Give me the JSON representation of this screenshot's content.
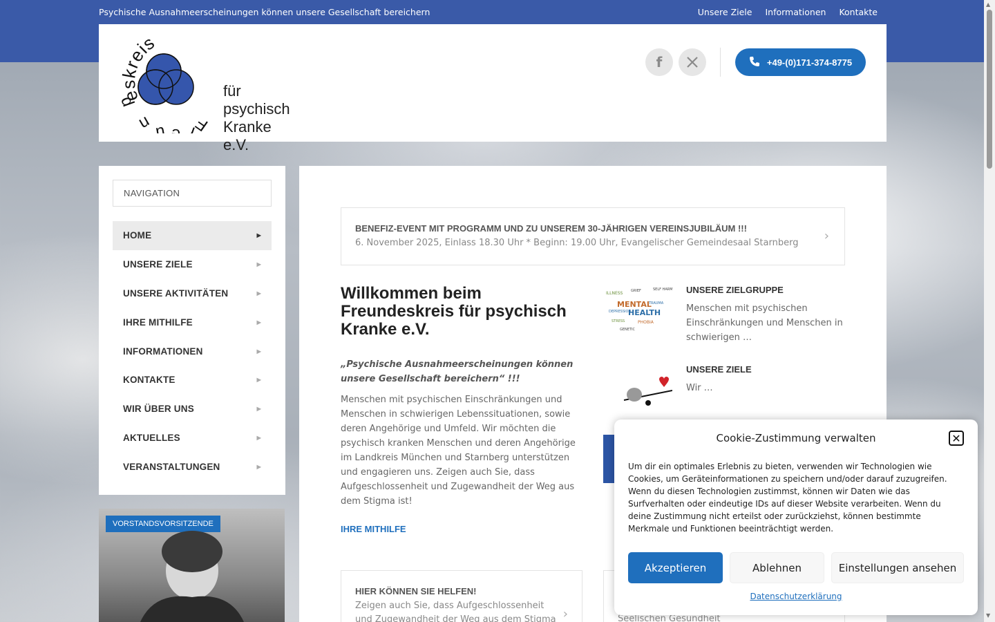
{
  "topbar": {
    "tagline": "Psychische Ausnahmeerscheinungen können unsere Gesellschaft bereichern",
    "links": [
      "Unsere Ziele",
      "Informationen",
      "Kontakte"
    ]
  },
  "header": {
    "logo_arc_text": "Freundeskreis",
    "logo_line1": "für psychisch",
    "logo_line2": "Kranke e.V.",
    "social_icons": [
      "facebook-icon",
      "x-icon"
    ],
    "phone": "+49-(0)171-374-8775",
    "accent_color": "#1f6fbd",
    "topbar_color": "#3a5aa8"
  },
  "sidebar": {
    "nav_heading": "NAVIGATION",
    "items": [
      {
        "label": "HOME",
        "active": true
      },
      {
        "label": "UNSERE ZIELE"
      },
      {
        "label": "UNSERE AKTIVITÄTEN"
      },
      {
        "label": "IHRE MITHILFE"
      },
      {
        "label": "INFORMATIONEN"
      },
      {
        "label": "KONTAKTE"
      },
      {
        "label": "WIR ÜBER UNS"
      },
      {
        "label": "AKTUELLES"
      },
      {
        "label": "VERANSTALTUNGEN"
      }
    ],
    "board_tag": "VORSTANDSVORSITZENDE"
  },
  "main": {
    "event_title": "BENEFIZ-EVENT MIT PROGRAMM UND ZU UNSEREM 30-JÄHRIGEN VEREINSJUBILÄUM !!!",
    "event_desc": "6. November 2025, Einlass 18.30 Uhr  * Beginn: 19.00 Uhr, Evangelischer Gemeindesaal Starnberg",
    "welcome_title": "Willkommen beim Freundeskreis für psychisch Kranke e.V.",
    "quote": "„Psychische Ausnahmeerscheinungen können unsere Gesellschaft bereichern“ !!!",
    "intro": "Menschen mit psychischen Einschränkungen und Menschen in schwierigen Lebenssituationen, sowie deren Angehörige und Umfeld. Wir möchten die psychisch kranken Menschen und deren Angehörige im Landkreis München und Starnberg unterstützen und engagieren uns. Zeigen auch Sie, dass Aufgeschlossenheit und Zugewandheit der Weg aus dem Stigma ist!",
    "help_link": "IHRE MITHILFE",
    "help_card_title": "HIER KÖNNEN SIE HELFEN!",
    "help_card_desc": "Zeigen auch Sie, dass Aufgeschlossenheit und Zugewandheit der Weg aus dem Stigma",
    "features": [
      {
        "title": "UNSERE ZIELGRUPPE",
        "desc": "Menschen mit psychischen Einschränkungen und Menschen in schwierigen …"
      },
      {
        "title": "UNSERE ZIELE",
        "desc": "Wir …"
      }
    ],
    "card2_desc": "Seelischen Gesundheit"
  },
  "cookie": {
    "title": "Cookie-Zustimmung verwalten",
    "text": "Um dir ein optimales Erlebnis zu bieten, verwenden wir Technologien wie Cookies, um Geräteinformationen zu speichern und/oder darauf zuzugreifen. Wenn du diesen Technologien zustimmst, können wir Daten wie das Surfverhalten oder eindeutige IDs auf dieser Website verarbeiten. Wenn du deine Zustimmung nicht erteilst oder zurückziehst, können bestimmte Merkmale und Funktionen beeinträchtigt werden.",
    "accept": "Akzeptieren",
    "deny": "Ablehnen",
    "preferences": "Einstellungen ansehen",
    "privacy_link": "Datenschutzerklärung"
  }
}
